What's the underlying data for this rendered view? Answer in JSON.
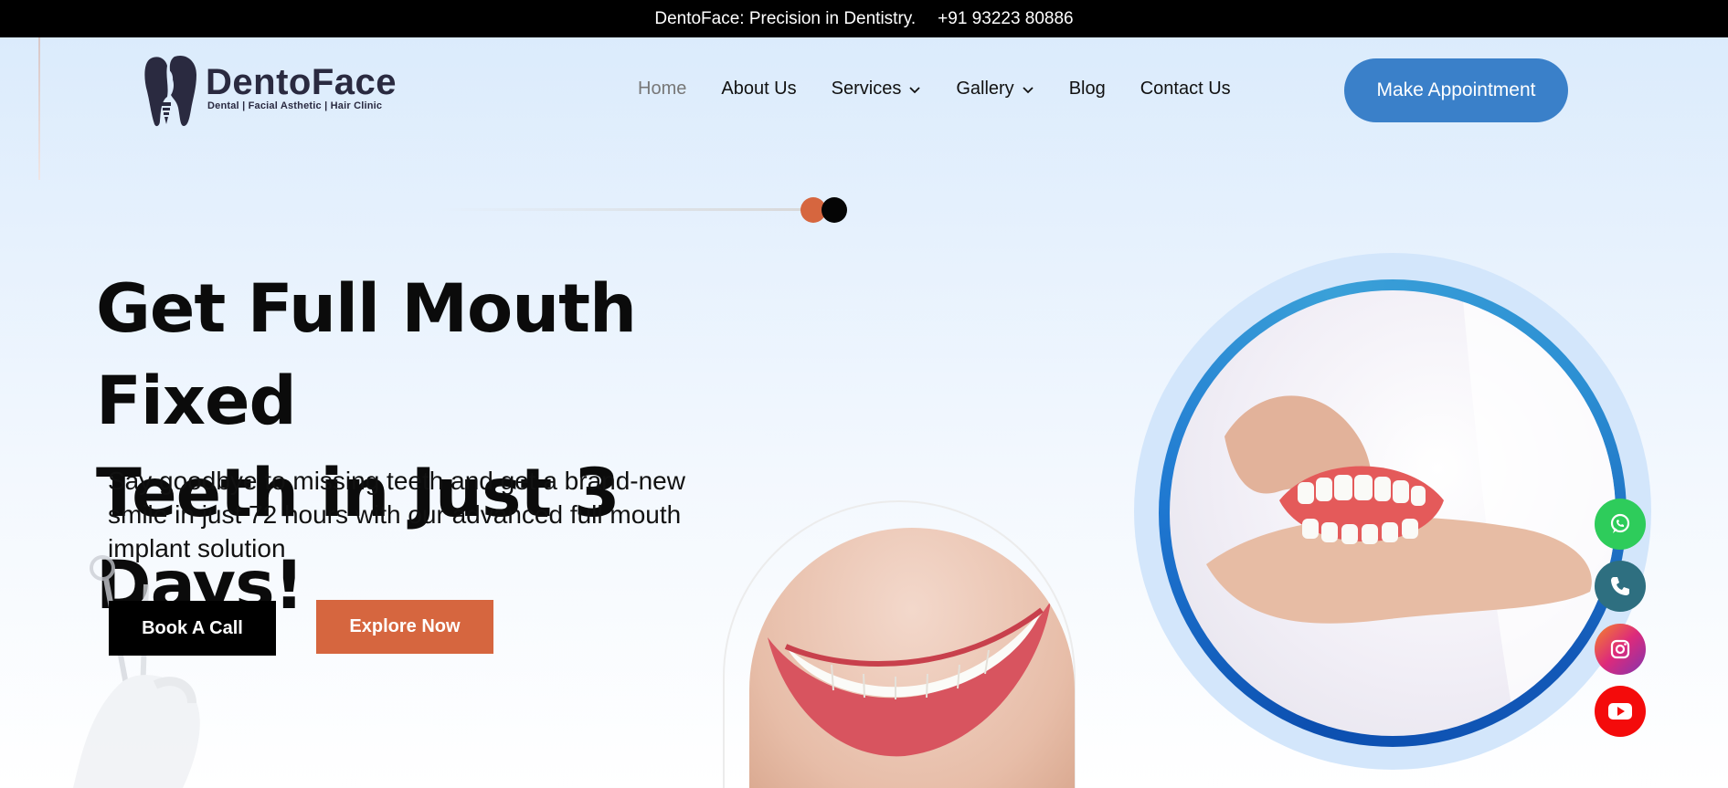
{
  "topbar": {
    "tagline": "DentoFace: Precision in Dentistry.",
    "phone": "+91 93223 80886"
  },
  "logo": {
    "brand": "DentoFace",
    "subtitle": "Dental | Facial Asthetic | Hair Clinic"
  },
  "nav": {
    "items": [
      {
        "label": "Home",
        "active": true,
        "has_dropdown": false
      },
      {
        "label": "About Us",
        "active": false,
        "has_dropdown": false
      },
      {
        "label": "Services",
        "active": false,
        "has_dropdown": true
      },
      {
        "label": "Gallery",
        "active": false,
        "has_dropdown": true
      },
      {
        "label": "Blog",
        "active": false,
        "has_dropdown": false
      },
      {
        "label": "Contact Us",
        "active": false,
        "has_dropdown": false
      }
    ],
    "cta_label": "Make Appointment"
  },
  "hero": {
    "headline_line1": "Get Full Mouth Fixed",
    "headline_line2": "Teeth in Just 3 Days!",
    "subtext": "Say goodbye to missing teeth and get a brand-new smile in just 72 hours with our advanced full mouth implant solution",
    "primary_button": "Book A Call",
    "secondary_button": "Explore Now"
  },
  "images": {
    "smile_photo": "smiling-lips-photo",
    "denture_photo": "hands-holding-denture-photo",
    "decor": "gloved-hand-dental-tools"
  },
  "social": [
    "whatsapp-icon",
    "phone-icon",
    "instagram-icon",
    "youtube-icon"
  ],
  "colors": {
    "accent_blue": "#3a80c9",
    "accent_orange": "#d6663f",
    "topbar_bg": "#000000",
    "whatsapp": "#2ecc5b",
    "phone": "#2e6f80",
    "youtube": "#f40b0b"
  }
}
